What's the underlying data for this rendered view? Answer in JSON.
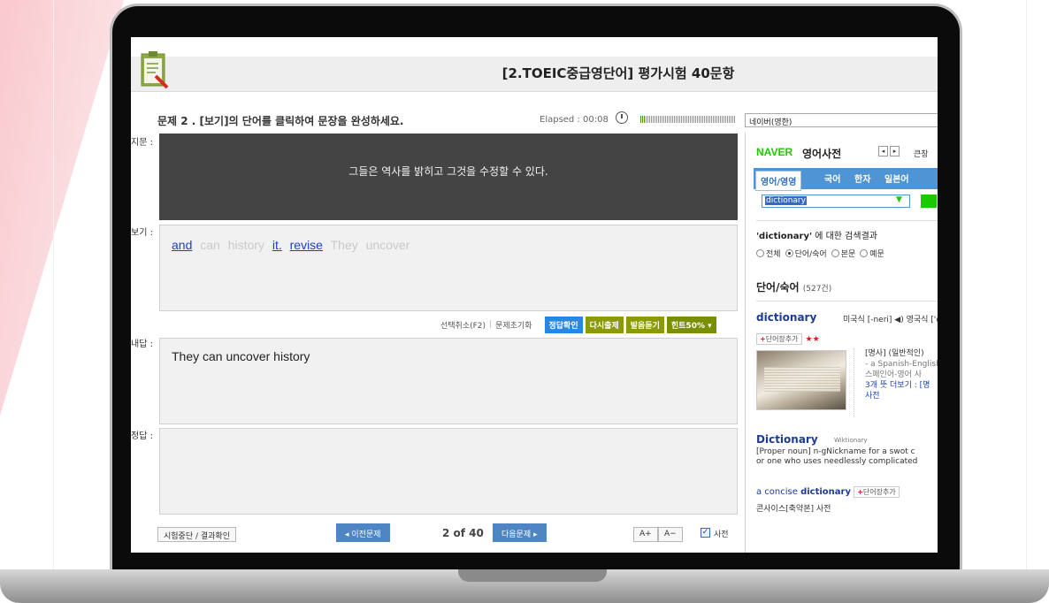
{
  "app": {
    "title": "[2.TOEIC중급영단어] 평가시험 40문항"
  },
  "question": {
    "instruction": "문제 2 . [보기]의 단어를 클릭하여 문장을 완성하세요.",
    "elapsed": "Elapsed : 00:08",
    "progress_fraction": 0.05,
    "prompt_label": "지문 :",
    "prompt_text": "그들은 역사를 밝히고 그것을 수정할 수 있다.",
    "choices_label": "보기 :",
    "choices": [
      {
        "text": "and",
        "used": true
      },
      {
        "text": "can",
        "used": false
      },
      {
        "text": "history",
        "used": false
      },
      {
        "text": "it.",
        "used": true
      },
      {
        "text": "revise",
        "used": true
      },
      {
        "text": "They",
        "used": false
      },
      {
        "text": "uncover",
        "used": false
      }
    ],
    "answer_label": "내답 :",
    "answer_text": "They can uncover history",
    "correct_label": "정답 :",
    "correct_text": ""
  },
  "toolbar": {
    "undo": "선택취소(F2)",
    "reset": "문제초기화",
    "check": "정답확인",
    "retry": "다시출제",
    "listen": "발음듣기",
    "hint": "힌트50% ▾"
  },
  "footer": {
    "stop": "시험중단 / 결과확인",
    "prev": "◂ 이전문제",
    "pager": "2 of 40",
    "next": "다음문제 ▸",
    "font_up": "A+",
    "font_down": "A−",
    "dict_checkbox": "사전",
    "dict_checked": true
  },
  "dictionary": {
    "source_select": "네이버(영한)",
    "brand": "NAVER",
    "title": "영어사전",
    "big_window": "큰창",
    "tabs": [
      "영어/영영",
      "국어",
      "한자",
      "일본어"
    ],
    "query": "dictionary",
    "result_query": "'dictionary'",
    "result_suffix": " 에 대한 검색결과",
    "filters": [
      {
        "label": "전체",
        "on": false
      },
      {
        "label": "단어/숙어",
        "on": true
      },
      {
        "label": "본문",
        "on": false
      },
      {
        "label": "예문",
        "on": false
      }
    ],
    "section_title": "단어/숙어",
    "section_count": "(527건)",
    "entry": {
      "word": "dictionary",
      "pron": "미국식 [-neri] ◀) 영국식 ['c",
      "add_label": "단어장추가",
      "stars": "★★",
      "meaning_pos": "[명사] (일반적인)",
      "example_en": "- a Spanish-English",
      "example_ko": "  스페인어-영어 사",
      "more": "3개 뜻 더보기 : [명",
      "more2": "사전"
    },
    "wiki": {
      "word": "Dictionary",
      "source": "Wiktionary",
      "def1": "[Proper noun] n-gNickname for a swot c",
      "def2": "or one who uses needlessly complicated"
    },
    "concise": {
      "pre": "a concise ",
      "word": "dictionary",
      "add_label": "단어장추가",
      "ko": "콘사이스[축약본] 사전"
    }
  }
}
